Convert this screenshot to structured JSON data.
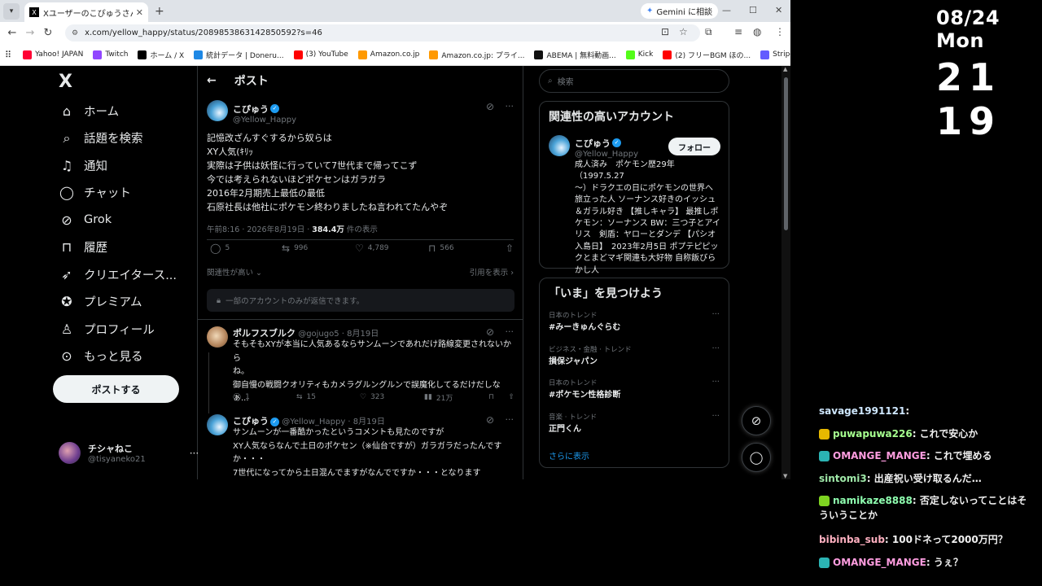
{
  "browser": {
    "tab_title": "Xユーザーのこぴゅうさん:「記憶改ざ",
    "tab_icon": "X",
    "gemini_label": "Gemini に相談",
    "url": "x.com/yellow_happy/status/2089853863142850592?s=46",
    "bookmarks": [
      "Yahoo! JAPAN",
      "Twitch",
      "ホーム / X",
      "統計データ | Doneru...",
      "(3) YouTube",
      "Amazon.co.jp",
      "Amazon.co.jp: プライ...",
      "ABEMA | 無料動画...",
      "Kick",
      "(2) フリーBGM ほの...",
      "Stripe Express"
    ],
    "bookmark_colors": [
      "#ff0033",
      "#9146ff",
      "#000000",
      "#1e88e5",
      "#ff0000",
      "#ff9900",
      "#ff9900",
      "#111111",
      "#53fc18",
      "#ff0000",
      "#635bff"
    ]
  },
  "leftnav": {
    "logo": "X",
    "items": [
      {
        "label": "ホーム",
        "icon": "home-icon"
      },
      {
        "label": "話題を検索",
        "icon": "search-icon"
      },
      {
        "label": "通知",
        "icon": "bell-icon"
      },
      {
        "label": "チャット",
        "icon": "chat-icon"
      },
      {
        "label": "Grok",
        "icon": "grok-icon"
      },
      {
        "label": "履歴",
        "icon": "bookmark-icon"
      },
      {
        "label": "クリエイタース...",
        "icon": "rocket-icon"
      },
      {
        "label": "プレミアム",
        "icon": "verified-icon"
      },
      {
        "label": "プロフィール",
        "icon": "person-icon"
      },
      {
        "label": "もっと見る",
        "icon": "more-icon"
      }
    ],
    "post_button": "ポストする",
    "account": {
      "name": "チシャねこ",
      "handle": "@tisyaneko21"
    }
  },
  "main": {
    "header": "ポスト",
    "tweet": {
      "name": "こぴゅう",
      "handle": "@Yellow_Happy",
      "lines": [
        "記憶改ざんすぐするから奴らは",
        "XY人気(ｷﾘｯ",
        "実際は子供は妖怪に行っていて7世代まで帰ってこず",
        "今では考えられないほどポケセンはガラガラ",
        "2016年2月期売上最低の最低",
        "石原社長は他社にポケモン終わりましたね言われてたんやぞ"
      ],
      "time": "午前8:16 · 2026年8月19日 · ",
      "views": "384.4万",
      "views_suffix": " 件の表示",
      "replies": "5",
      "retweets": "996",
      "likes": "4,789",
      "bookmarks": "566",
      "relevance": "関連性が高い",
      "quotes": "引用を表示"
    },
    "reply_restricted": "一部のアカウントのみが返信できます。",
    "replies": [
      {
        "name": "ポルフスブルク",
        "handle": "@gojugo5",
        "date": "· 8月19日",
        "lines": [
          "そもそもXYが本当に人気あるならサンムーンであれだけ路線変更されないから",
          "ね。",
          "御自慢の戦闘クオリティもカメラグルングルンで誤魔化してるだけだしな",
          "ぁ..."
        ],
        "replies": "1",
        "retweets": "15",
        "likes": "323",
        "views": "21万"
      },
      {
        "name": "こぴゅう",
        "handle": "@Yellow_Happy",
        "date": "· 8月19日",
        "lines": [
          "サンムーンが一番酷かったというコメントも見たのですが",
          "XY人気ならなんで土日のポケセン（※仙台ですが）ガラガラだったんです",
          "か・・・",
          "7世代になってから土日混んでますがなんでですか・・・となります"
        ]
      }
    ]
  },
  "right": {
    "search_placeholder": "検索",
    "related_title": "関連性の高いアカウント",
    "related": {
      "name": "こぴゅう",
      "handle": "@Yellow_Happy",
      "follow": "フォロー",
      "bio": [
        "成人済み　ポケモン歴29年（1997.5.27",
        "～）ドラクエの日にポケモンの世界へ",
        "旅立った人 ソーナンス好きのイッシュ",
        "＆ガラル好き 【推しキャラ】 最推しポ",
        "ケモン：ソーナンス BW：三つ子とアイ",
        "リス　剣盾：ヤローとダンデ 【パシオ",
        "入島日】　2023年2月5日 ポプテピピッ",
        "クとまどマギ関連も大好物 自称飯びら",
        "かし人"
      ]
    },
    "trends_title": "「いま」を見つけよう",
    "trends": [
      {
        "category": "日本のトレンド",
        "name": "#みーきゅんぐらむ"
      },
      {
        "category": "ビジネス・金融 · トレンド",
        "name": "損保ジャパン"
      },
      {
        "category": "日本のトレンド",
        "name": "#ポケモン性格診断"
      },
      {
        "category": "音楽 · トレンド",
        "name": "正門くん"
      }
    ],
    "show_more": "さらに表示"
  },
  "overlay": {
    "date": "08/24 Mon",
    "time": "21 19",
    "chat": [
      {
        "user": "savage1991121",
        "text": "",
        "badge_color": ""
      },
      {
        "user": "puwapuwa226",
        "text": "これで安心か",
        "badge_color": "#e6b800"
      },
      {
        "user": "OMANGE_MANGE",
        "text": "これで埋める",
        "badge_color": "#2bb3b3"
      },
      {
        "user": "sintomi3",
        "text": "出産祝い受け取るんだ…",
        "badge_color": ""
      },
      {
        "user": "namikaze8888",
        "text": "否定しないってことはそ",
        "text2": "ういうことか",
        "badge_color": "#7ed321"
      },
      {
        "user": "bibinba_sub",
        "text": "100ドネって2000万円？",
        "badge_color": ""
      },
      {
        "user": "OMANGE_MANGE",
        "text": "うぇ？",
        "badge_color": "#2bb3b3"
      }
    ],
    "chat_user_colors": [
      "#cfe8ff",
      "#a6ff8f",
      "#ff9de0",
      "#9fe8a8",
      "#8fffb0",
      "#ffb0c0",
      "#ff9de0"
    ]
  }
}
